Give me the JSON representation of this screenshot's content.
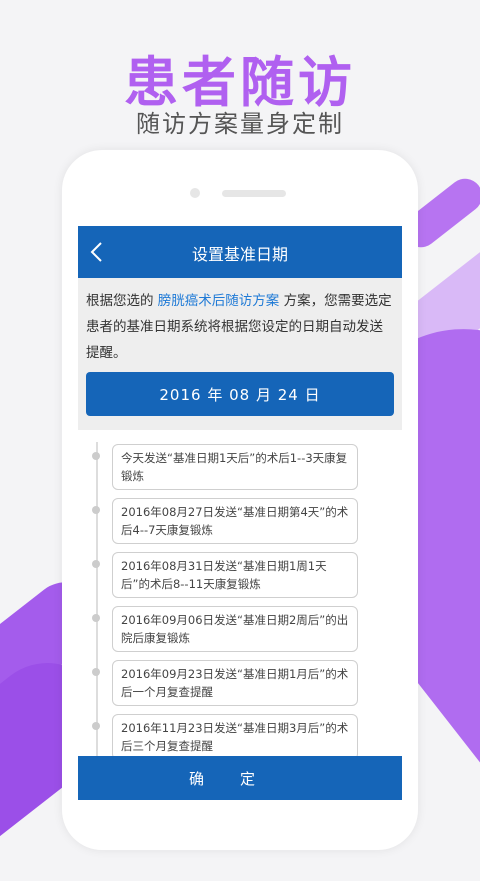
{
  "hero": {
    "title": "患者随访",
    "subtitle": "随访方案量身定制"
  },
  "nav": {
    "title": "设置基准日期"
  },
  "intro": {
    "prefix": "根据您选的",
    "plan": "膀胱癌术后随访方案",
    "suffix": "方案，您需要选定患者的基准日期系统将根据您设定的日期自动发送提醒。"
  },
  "date_button": {
    "label": "2016 年 08 月 24 日"
  },
  "timeline": [
    {
      "text": "今天发送“基准日期1天后”的术后1--3天康复锻炼"
    },
    {
      "text": "2016年08月27日发送“基准日期第4天”的术后4--7天康复锻炼"
    },
    {
      "text": "2016年08月31日发送“基准日期1周1天后”的术后8--11天康复锻炼"
    },
    {
      "text": "2016年09月06日发送“基准日期2周后”的出院后康复锻炼"
    },
    {
      "text": "2016年09月23日发送“基准日期1月后”的术后一个月复查提醒"
    },
    {
      "text": "2016年11月23日发送“基准日期3月后”的术后三个月复查提醒"
    }
  ],
  "confirm": {
    "label": "确定"
  },
  "colors": {
    "accent": "#1565b8",
    "brand_purple": "#b060f0",
    "highlight": "#1f7ad6"
  }
}
